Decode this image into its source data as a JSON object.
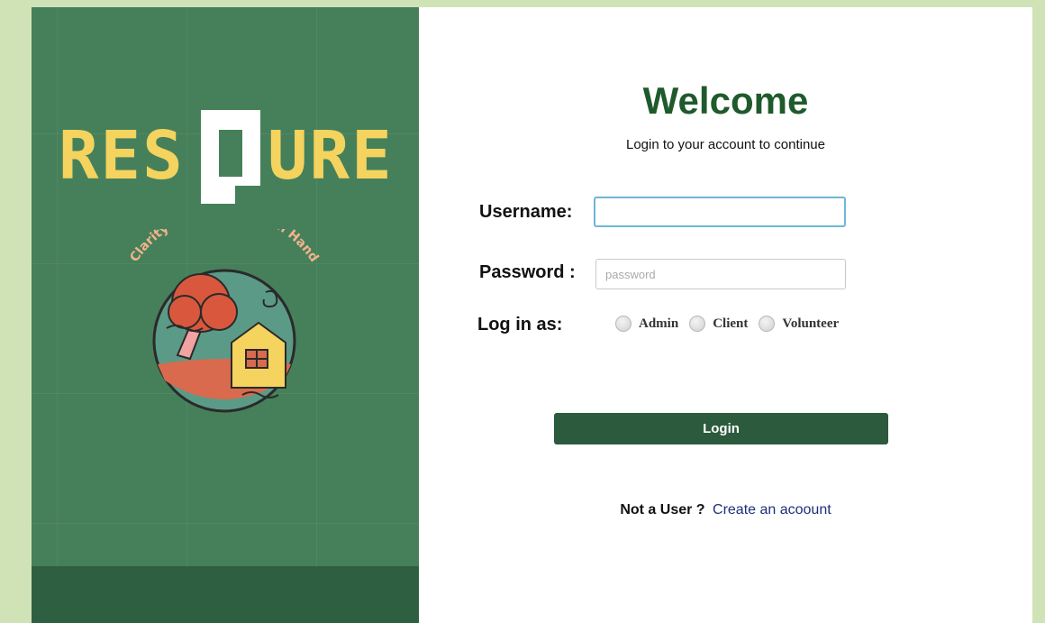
{
  "brand": {
    "logo_text": "RESQURE",
    "tagline": "Clarity in Crisis, Help in Hand"
  },
  "login": {
    "title": "Welcome",
    "subtitle": "Login to your account to continue",
    "username_label": "Username:",
    "username_value": "",
    "password_label": "Password :",
    "password_placeholder": "password",
    "role_label": "Log in as:",
    "roles": [
      "Admin",
      "Client",
      "Volunteer"
    ],
    "submit_label": "Login",
    "signup_prompt": "Not a User ?",
    "signup_link": "Create an acoount"
  },
  "colors": {
    "page_bg": "#cfe3b7",
    "panel_green": "#46805a",
    "panel_footer": "#2f5f41",
    "logo_yellow": "#f4d35e",
    "heading_green": "#1f5a2c",
    "button_green": "#2c5a3c",
    "focus_blue": "#6fb6d6",
    "link_blue": "#1e2f7a"
  }
}
